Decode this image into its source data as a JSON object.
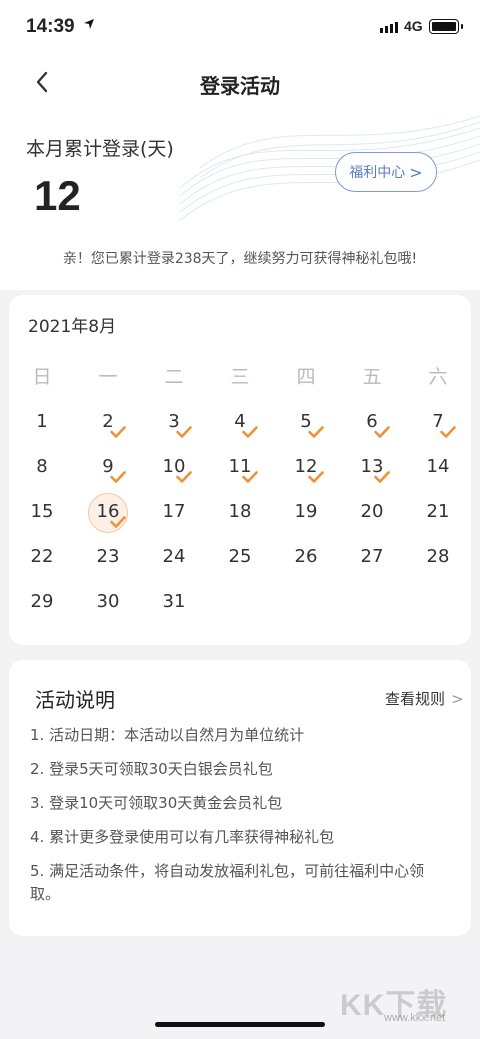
{
  "status_bar": {
    "time": "14:39",
    "location_icon": "location-arrow-icon",
    "network": "4G"
  },
  "nav": {
    "title": "登录活动",
    "back_icon": "chevron-left-icon"
  },
  "summary": {
    "label": "本月累计登录(天)",
    "count": "12",
    "welfare_button": "福利中心",
    "welfare_chevron": ">",
    "message": "亲！您已累计登录238天了，继续努力可获得神秘礼包哦!"
  },
  "calendar": {
    "month": "2021年8月",
    "weekdays": [
      "日",
      "一",
      "二",
      "三",
      "四",
      "五",
      "六"
    ],
    "days": [
      "1",
      "2",
      "3",
      "4",
      "5",
      "6",
      "7",
      "8",
      "9",
      "10",
      "11",
      "12",
      "13",
      "14",
      "15",
      "16",
      "17",
      "18",
      "19",
      "20",
      "21",
      "22",
      "23",
      "24",
      "25",
      "26",
      "27",
      "28",
      "29",
      "30",
      "31"
    ],
    "checked_days": [
      2,
      3,
      4,
      5,
      6,
      7,
      9,
      10,
      11,
      12,
      13,
      16
    ],
    "today": 16,
    "check_color": "#f0913a"
  },
  "rules": {
    "title": "活动说明",
    "link": "查看规则",
    "link_chevron": ">",
    "items": [
      "1. 活动日期：本活动以自然月为单位统计",
      "2. 登录5天可领取30天白银会员礼包",
      "3. 登录10天可领取30天黄金会员礼包",
      "4. 累计更多登录使用可以有几率获得神秘礼包",
      "5. 满足活动条件，将自动发放福利礼包，可前往福利中心领取。"
    ]
  },
  "watermark": {
    "brand": "KK下载",
    "url": "www.kkx.net"
  }
}
